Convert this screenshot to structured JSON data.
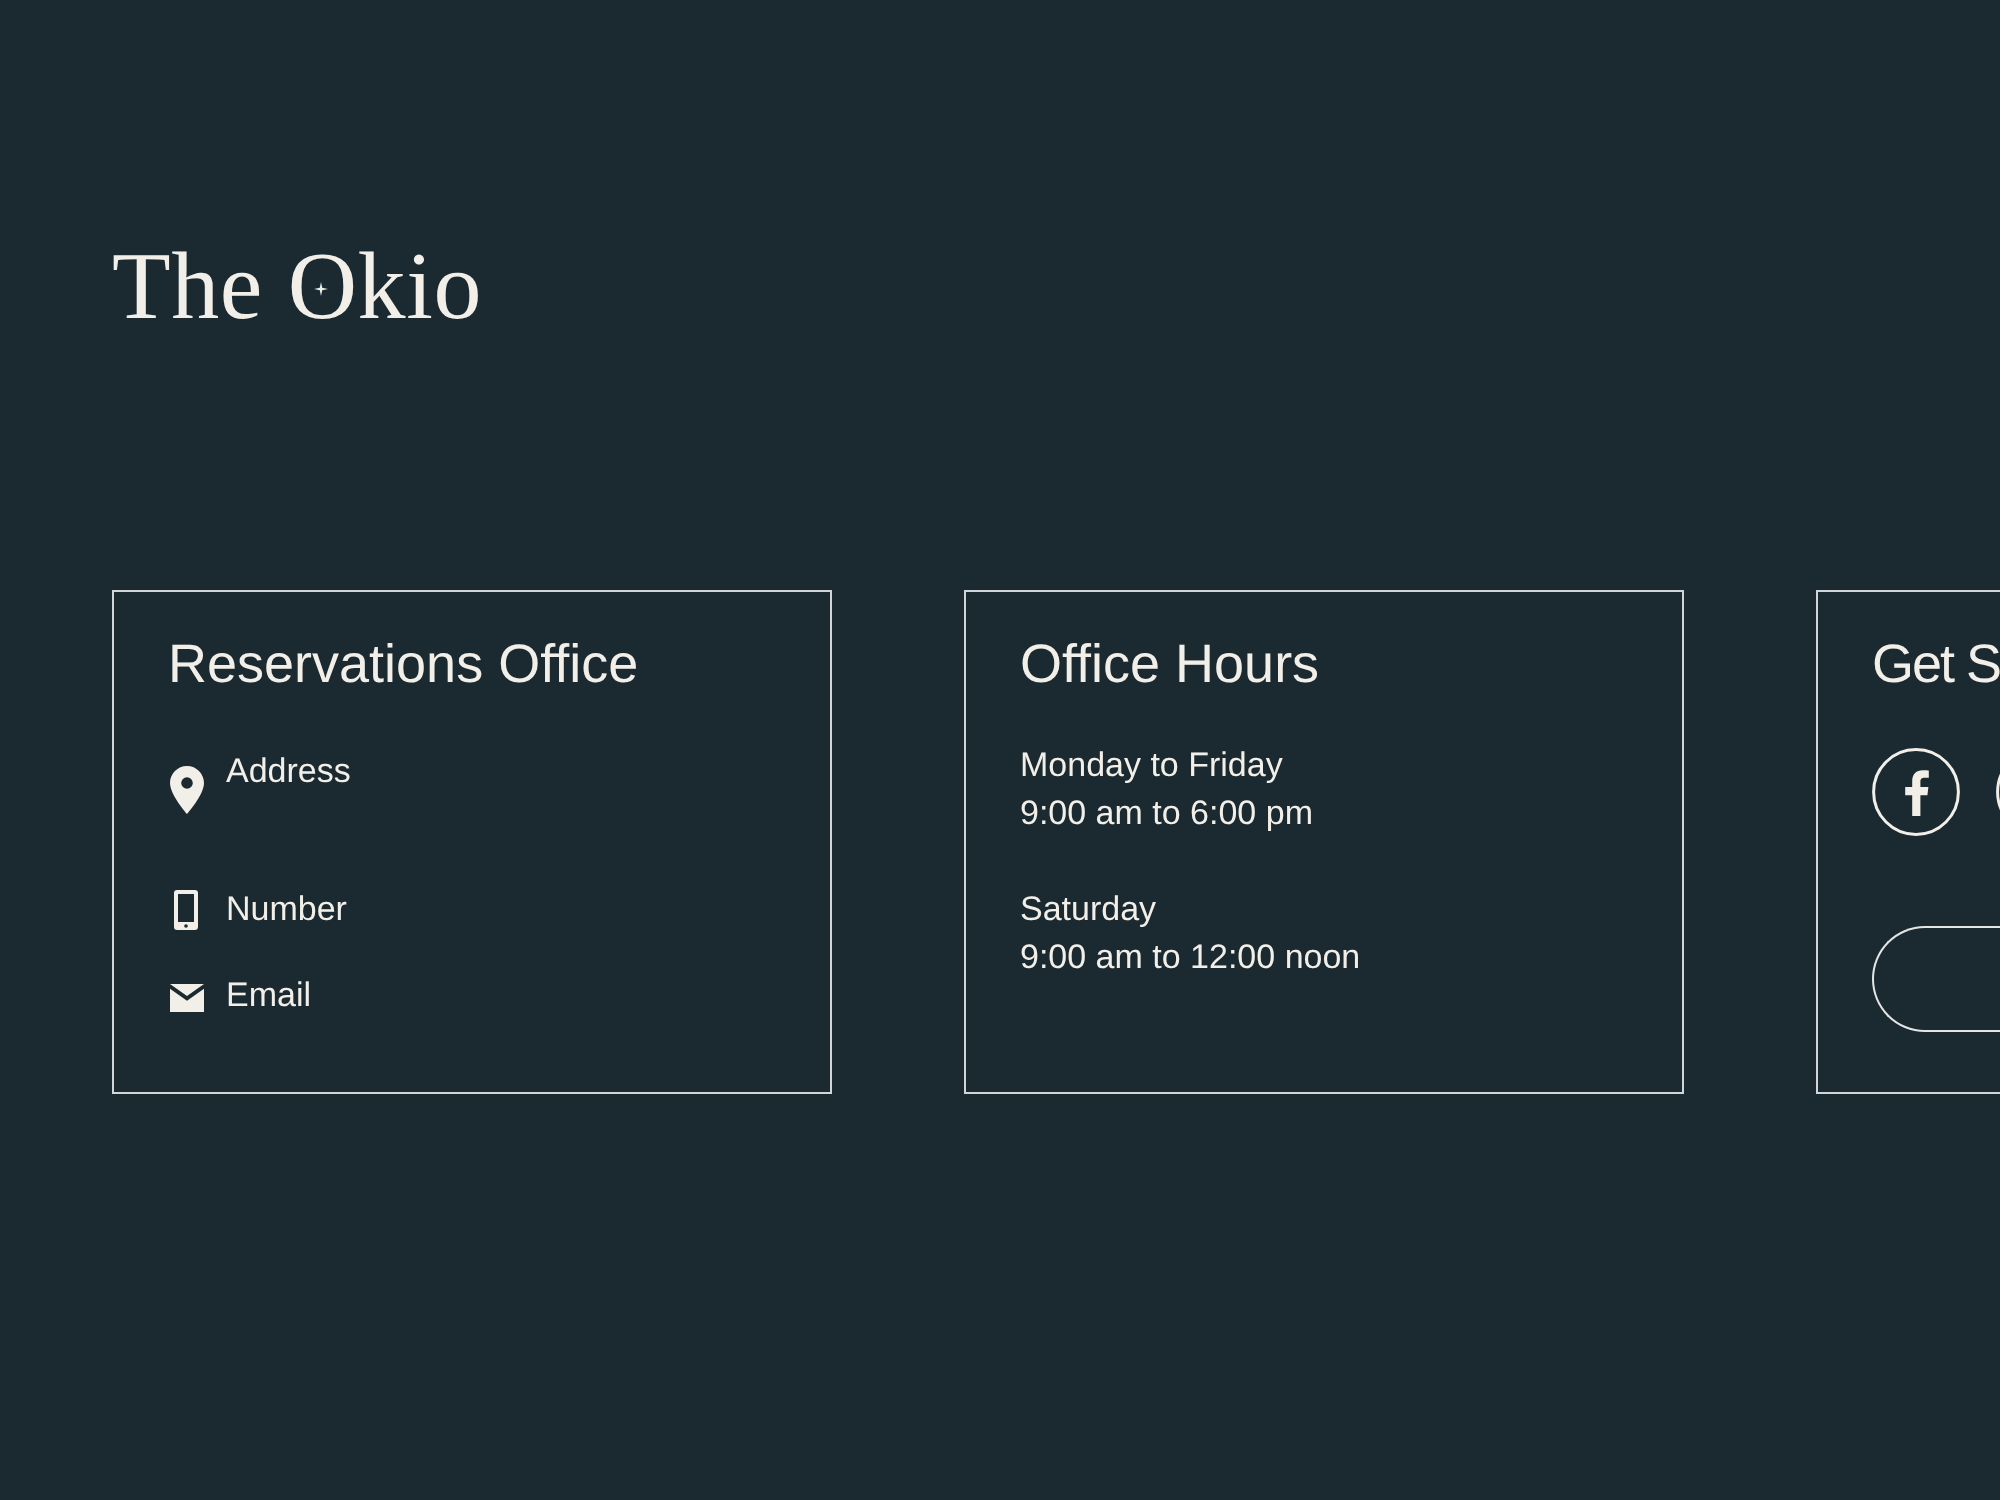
{
  "logo": "The Okio",
  "cards": [
    {
      "kind": "contact",
      "title": "Reservations Office",
      "items": [
        {
          "kind": "address",
          "label": "Address"
        },
        {
          "kind": "phone",
          "label": "Number"
        },
        {
          "kind": "email",
          "label": "Email"
        }
      ]
    },
    {
      "kind": "hours",
      "title": "Office Hours",
      "schedule": [
        {
          "days": "Monday to Friday",
          "hours": "9:00 am to 6:00 pm"
        },
        {
          "days": "Saturday",
          "hours": "9:00 am to 12:00 noon"
        }
      ]
    },
    {
      "kind": "social",
      "title": "Get S",
      "links": [
        {
          "kind": "facebook"
        },
        {
          "kind": "circle"
        }
      ]
    }
  ]
}
